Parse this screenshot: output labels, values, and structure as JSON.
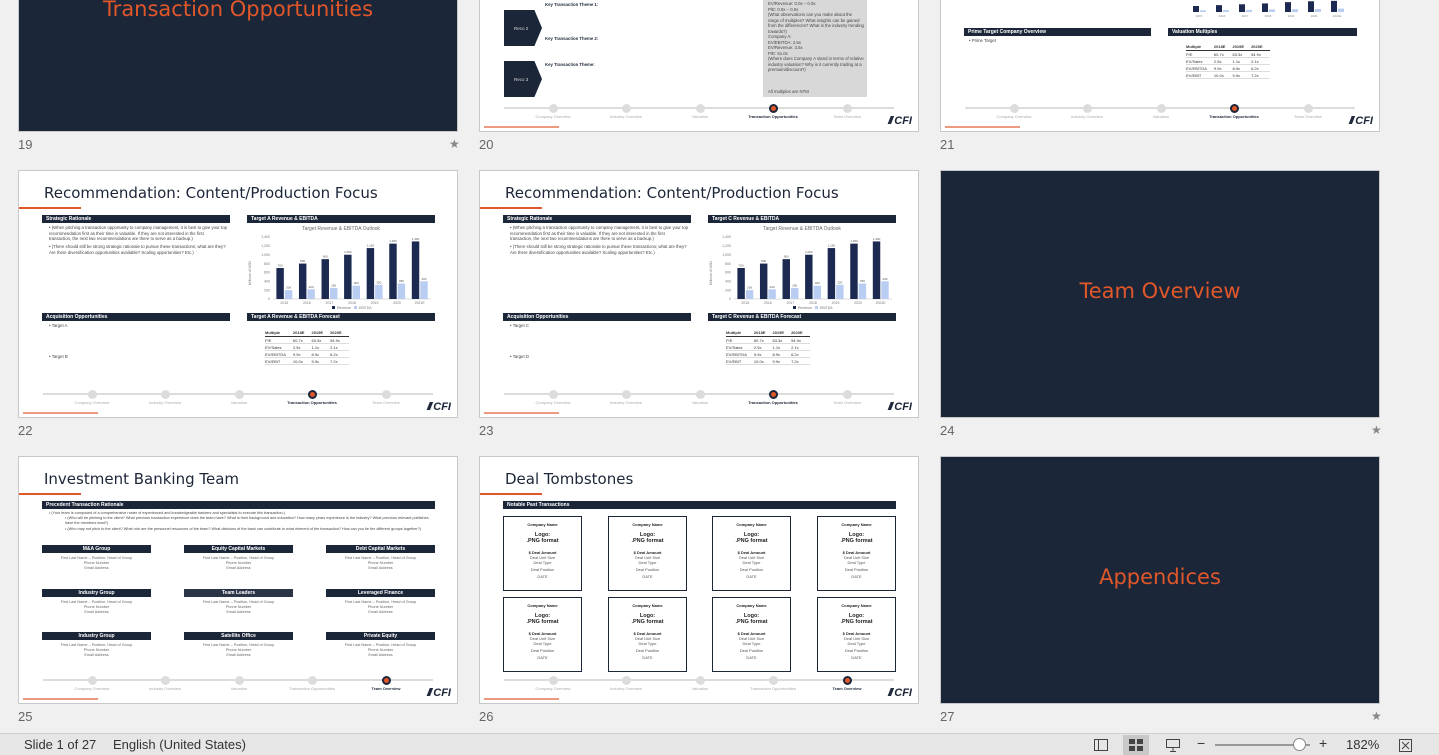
{
  "slides": {
    "s19": {
      "num": "19",
      "title": "Transaction Opportunities",
      "star": "★"
    },
    "s20": {
      "num": "20",
      "reco2": "Reco 2",
      "reco3": "Reco 3",
      "theme1": "Key Transaction Theme 1:",
      "theme2": "Key Transaction Theme 2:",
      "theme3": "Key Transaction Theme:",
      "note": "All multiples are NTM",
      "lines": [
        "EV/Revenue: 0.0x – 0.0x",
        "P/E: 0.0x – 0.0x",
        "(What observations can you make about the range of multiples? What insights can be gained from the differences? What is the industry trending towards?)",
        "Company A:",
        "EV/EBITDA: 2.5x",
        "EV/Revenue: 3.5x",
        "P/E: 51.0x",
        "(Where does Company A stand in terms of relative industry valuation? Why is it currently trading at a premium/discount?)"
      ]
    },
    "s21": {
      "num": "21",
      "box1": "Prime Target Company Overview",
      "bullet": "Prime Target",
      "box2": "Valuation Multiples",
      "head": [
        "Multiple",
        "2018E",
        "2019E",
        "2020E"
      ],
      "rows": [
        [
          "P/E",
          "60.7x",
          "63.3x",
          "54.9x"
        ],
        [
          "EV/Sales",
          "2.5x",
          "1.1x",
          "2.1x"
        ],
        [
          "EV/EBITDA",
          "9.9x",
          "8.9x",
          "6.2x"
        ],
        [
          "EV/EBIT",
          "10.0x",
          "9.9x",
          "7.2x"
        ]
      ]
    },
    "s22": {
      "num": "22",
      "title": "Recommendation: Content/Production Focus",
      "box1": "Strategic Rationale",
      "box2": "Target A Revenue & EBITDA",
      "chart_title": "Target Revenue & EBITDA Outlook",
      "box3": "Acquisition Opportunities",
      "box4": "Target A Revenue & EBITDA Forecast",
      "r1": "(When pitching a transaction opportunity to company management, it is best to give your top recommendation first as their time is valuable. If they are not interested in the first transaction, the next two recommendations are there to serve as a backup.)",
      "r2": "(There should still be strong strategic rationale to pursue these transactions; what are they? Are there diversification opportunities available? Scaling opportunities? Etc.)",
      "a1": "Target A",
      "a2": "Target B"
    },
    "s23": {
      "num": "23",
      "title": "Recommendation: Content/Production Focus",
      "box2": "Target C Revenue & EBITDA",
      "box4": "Target C Revenue & EBITDA Forecast",
      "a1": "Target C",
      "a2": "Target D"
    },
    "s24": {
      "num": "24",
      "title": "Team Overview",
      "star": "★"
    },
    "s25": {
      "num": "25",
      "title": "Investment Banking Team",
      "box": "Precedent Transaction Rationale",
      "t1": "(Your team is composed of a comprehensive roster of experienced and knowledgeable bankers and specialists to execute this transaction.)",
      "t2": "(Who will be pitching to the client? What previous transaction experience does the team have? What is their background and education? How many years experience is the industry? What previous relevant publishes have the members lead?)",
      "t3": "(Who may not pitch to the client? What role are the personnel resources of the team? What divisions of the bank can contribute to what element of the transaction? How can you tie the different groups together?)",
      "groups": [
        "M&A Group",
        "Equity Capital Markets",
        "Debt Capital Markets",
        "Industry Group",
        "Team Leaders",
        "Leveraged Finance",
        "Industry Group",
        "Satellite Office",
        "Private Equity"
      ],
      "contact1": "First Last Name – Position, Head of Group",
      "contact2": "Phone Number",
      "contact3": "Email Address"
    },
    "s26": {
      "num": "26",
      "title": "Deal Tombstones",
      "box": "Notable Past Transactions",
      "cname": "Company Name",
      "logo1": "Logo:",
      "logo2": ".PNG format",
      "amount": "$ Deal Amount",
      "l1": "Deal Unit Size",
      "l2": "Deal Type",
      "l3": "Deal Position",
      "l4": "DATE"
    },
    "s27": {
      "num": "27",
      "title": "Appendices",
      "star": "★"
    }
  },
  "progress": {
    "labels": [
      "Company Overview",
      "Industry Overview",
      "Valuation",
      "Transaction Opportunities",
      "Team Overview"
    ],
    "active_transaction": 3,
    "active_team": 4
  },
  "logo": "CFI",
  "chart_data": {
    "type": "bar",
    "title": "Target Revenue & EBITDA Outlook",
    "categories": [
      "2015",
      "2016",
      "2017",
      "2018",
      "2019",
      "2020",
      "2021E"
    ],
    "series": [
      {
        "name": "Revenue",
        "values": [
          700,
          800,
          900,
          1000,
          1150,
          1250,
          1300
        ]
      },
      {
        "name": "EBITDA",
        "values": [
          200,
          220,
          250,
          300,
          320,
          350,
          400
        ]
      }
    ],
    "ylim": [
      0,
      1400
    ],
    "yticks": [
      "1,400",
      "1,200",
      "1,000",
      "800",
      "600",
      "400",
      "200",
      "0"
    ],
    "ylabel": "Millions of USD"
  },
  "statusbar": {
    "slide_info": "Slide 1 of 27",
    "language": "English (United States)",
    "zoom": "182%",
    "minus": "−",
    "plus": "+"
  }
}
